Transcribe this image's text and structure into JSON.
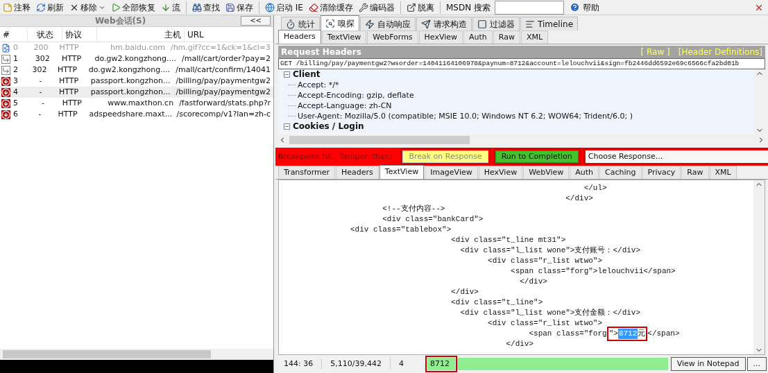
{
  "toolbar": {
    "groups": [
      [
        {
          "label": "注释",
          "dropdown": false
        },
        {
          "label": "刷新",
          "dropdown": false
        },
        {
          "label": "移除",
          "dropdown": true
        },
        {
          "label": "全部恢复",
          "dropdown": false
        },
        {
          "label": "流",
          "dropdown": false
        }
      ],
      [
        {
          "label": "查找",
          "dropdown": false
        },
        {
          "label": "保存",
          "dropdown": false
        }
      ],
      [
        {
          "label": "启动 IE",
          "dropdown": false
        },
        {
          "label": "清除缓存",
          "dropdown": false
        },
        {
          "label": "编码器",
          "dropdown": false
        }
      ],
      [
        {
          "label": "脱离",
          "dropdown": false
        }
      ]
    ],
    "search": {
      "label": "MSDN 搜索"
    },
    "help": "帮助"
  },
  "sessions": {
    "title": "Web会话(S)",
    "collapse": "<<",
    "columns": [
      "#",
      "状态",
      "协议",
      "主机",
      "URL"
    ],
    "rows": [
      {
        "kind": "image",
        "id": "0",
        "status": "200",
        "protocol": "HTTP",
        "host": "hm.baidu.com",
        "url": "/hm.gif?cc=1&ck=1&cl=3",
        "selected": false,
        "dimmed": true
      },
      {
        "kind": "redirect",
        "id": "1",
        "status": "302",
        "protocol": "HTTP",
        "host": "do.gw2.kongzhong....",
        "url": "/mall/cart/order?pay=2",
        "selected": false,
        "dimmed": false
      },
      {
        "kind": "redirect",
        "id": "2",
        "status": "302",
        "protocol": "HTTP",
        "host": "do.gw2.kongzhong....",
        "url": "/mall/cart/confirm/14041",
        "selected": false,
        "dimmed": false
      },
      {
        "kind": "breakpoint",
        "id": "3",
        "status": "-",
        "protocol": "HTTP",
        "host": "passport.kongzhon...",
        "url": "/billing/pay/paymentgw2",
        "selected": false,
        "dimmed": false
      },
      {
        "kind": "breakpoint",
        "id": "4",
        "status": "-",
        "protocol": "HTTP",
        "host": "passport.kongzhon...",
        "url": "/billing/pay/paymentgw2",
        "selected": true,
        "dimmed": false
      },
      {
        "kind": "breakpoint",
        "id": "5",
        "status": "-",
        "protocol": "HTTP",
        "host": "www.maxthon.cn",
        "url": "/fastforward/stats.php?r",
        "selected": false,
        "dimmed": false
      },
      {
        "kind": "breakpoint",
        "id": "6",
        "status": "-",
        "protocol": "HTTP",
        "host": "adspeedshare.maxt...",
        "url": "/scorecomp/v1?lan=zh-c",
        "selected": false,
        "dimmed": false
      }
    ]
  },
  "main_tabs": [
    {
      "label": "统计",
      "selected": false
    },
    {
      "label": "嗅探",
      "selected": true
    },
    {
      "label": "自动响应",
      "selected": false
    },
    {
      "label": "请求构造",
      "selected": false
    },
    {
      "label": "过滤器",
      "selected": false
    },
    {
      "label": "Timeline",
      "selected": false
    }
  ],
  "request": {
    "tabs": [
      {
        "label": "Headers",
        "selected": true
      },
      {
        "label": "TextView",
        "selected": false
      },
      {
        "label": "WebForms",
        "selected": false
      },
      {
        "label": "HexView",
        "selected": false
      },
      {
        "label": "Auth",
        "selected": false
      },
      {
        "label": "Raw",
        "selected": false
      },
      {
        "label": "XML",
        "selected": false
      }
    ],
    "title": "Request Headers",
    "links": [
      "[ Raw ]",
      "[Header Definitions]"
    ],
    "request_line": "GET /billing/pay/paymentgw2?wsorder=14041164106978&paynum=8712&account=lelouchvii&sign=fb2446dd6592e69c6566cfa2bd01b",
    "groups": [
      {
        "name": "Client",
        "expanded": true,
        "children": [
          {
            "text": "Accept: */*"
          },
          {
            "text": "Accept-Encoding: gzip, deflate"
          },
          {
            "text": "Accept-Language: zh-CN"
          },
          {
            "text": "User-Agent: Mozilla/5.0 (compatible; MSIE 10.0; Windows NT 6.2; WOW64; Trident/6.0; )"
          }
        ]
      },
      {
        "name": "Cookies / Login",
        "expanded": true
      }
    ]
  },
  "breakpoint": {
    "message": "Breakpoint hit.  Tamper, then:",
    "buttons": [
      {
        "kind": "break",
        "label": "Break on Response",
        "annotated": true
      },
      {
        "kind": "run",
        "label": "Run to Completion",
        "annotated": true
      }
    ],
    "response_select": {
      "value": "Choose Response...",
      "annotated": true
    }
  },
  "response": {
    "tabs": [
      {
        "label": "Transformer",
        "selected": false
      },
      {
        "label": "Headers",
        "selected": false
      },
      {
        "label": "TextView",
        "selected": true
      },
      {
        "label": "ImageView",
        "selected": false
      },
      {
        "label": "HexView",
        "selected": false
      },
      {
        "label": "WebView",
        "selected": false
      },
      {
        "label": "Auth",
        "selected": false
      },
      {
        "label": "Caching",
        "selected": false
      },
      {
        "label": "Privacy",
        "selected": false
      },
      {
        "label": "Raw",
        "selected": false
      },
      {
        "label": "XML",
        "selected": false
      }
    ],
    "code_lines": [
      {
        "text": "                                                                  </ul>"
      },
      {
        "text": "                                                              </div>"
      },
      {
        "text": "                      <!--支付内容-->"
      },
      {
        "text": "                      <div class=\"bankCard\">"
      },
      {
        "text": "               <div class=\"tablebox\">"
      },
      {
        "text": "                                     <div class=\"t_line mt31\">"
      },
      {
        "text": "                                       <div class=\"l_list wone\">支付账号：</div>"
      },
      {
        "text": "                                             <div class=\"r_list wtwo\">"
      },
      {
        "text": "                                                  <span class=\"forg\">lelouchvii</span>"
      },
      {
        "text": "                                                    </div>"
      },
      {
        "text": "                                     </div>"
      },
      {
        "text": "                                     <div class=\"t_line\">"
      },
      {
        "text": "                                       <div class=\"l_list wone\">支付金额：</div>"
      },
      {
        "text": "                                             <div class=\"r_list wtwo\">"
      },
      {
        "before": "                                                      <span class=\"forg",
        "after_before": "\">",
        "selected_text": "8712",
        "after": "元</span>",
        "annotated": true
      },
      {
        "text": "                                                 </div>"
      }
    ]
  },
  "status": {
    "cursor": "144: 36",
    "size": "5,110/39,442",
    "selection_length": "4",
    "quickexec": {
      "value": "8712",
      "annotated": true
    },
    "buttons": [
      "View in Notepad",
      "..."
    ]
  }
}
